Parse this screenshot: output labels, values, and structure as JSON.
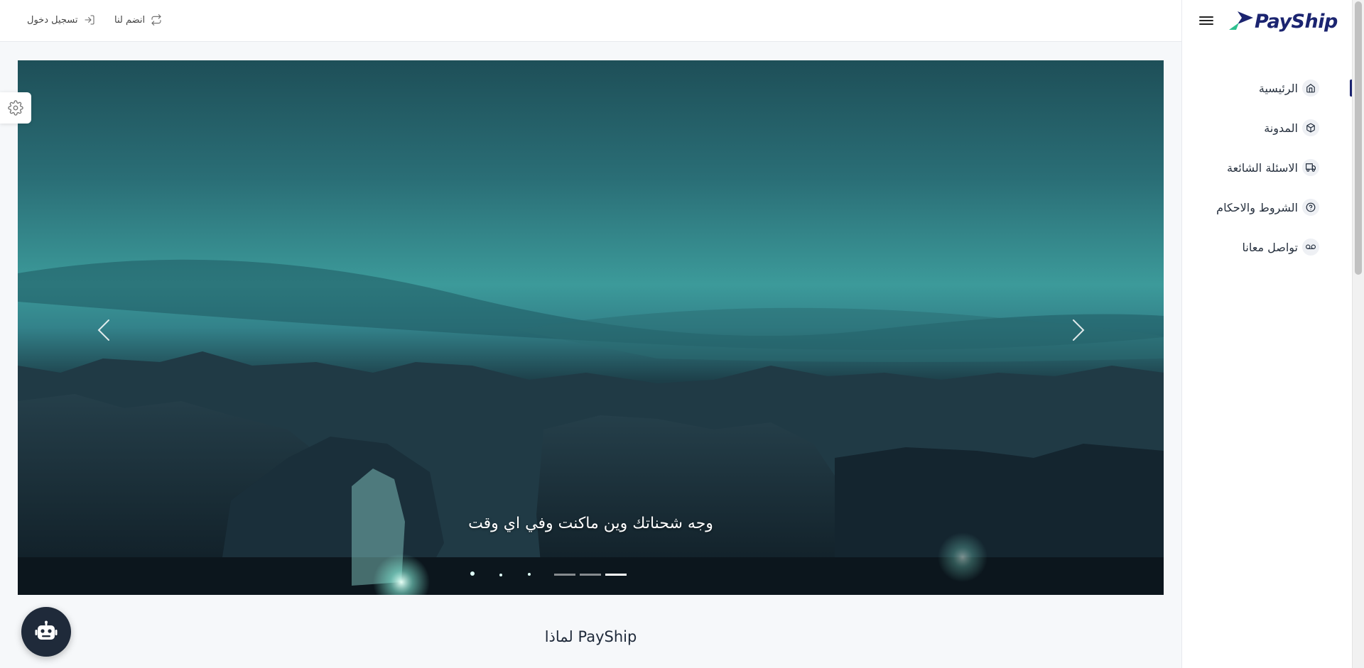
{
  "topbar": {
    "join_label": "انضم لنا",
    "login_label": "تسجيل دخول"
  },
  "brand": {
    "name": "PayShip",
    "colors": {
      "primary": "#1b2470",
      "accent": "#2dbf8f"
    }
  },
  "sidebar": {
    "items": [
      {
        "label": "الرئيسية",
        "icon": "home-icon",
        "active": true
      },
      {
        "label": "المدونة",
        "icon": "box-icon",
        "active": false
      },
      {
        "label": "الاسئلة الشائعة",
        "icon": "truck-icon",
        "active": false
      },
      {
        "label": "الشروط والاحكام",
        "icon": "help-circle-icon",
        "active": false
      },
      {
        "label": "تواصل معانا",
        "icon": "voicemail-icon",
        "active": false
      }
    ]
  },
  "hero": {
    "caption": "وجه شحناتك وين ماكنت وفي اي وقت",
    "slide_count": 3,
    "active_slide": 3
  },
  "section": {
    "title": "لماذا PayShip"
  },
  "chatbot": {
    "icon": "robot-icon"
  },
  "settings": {
    "icon": "gear-icon"
  }
}
